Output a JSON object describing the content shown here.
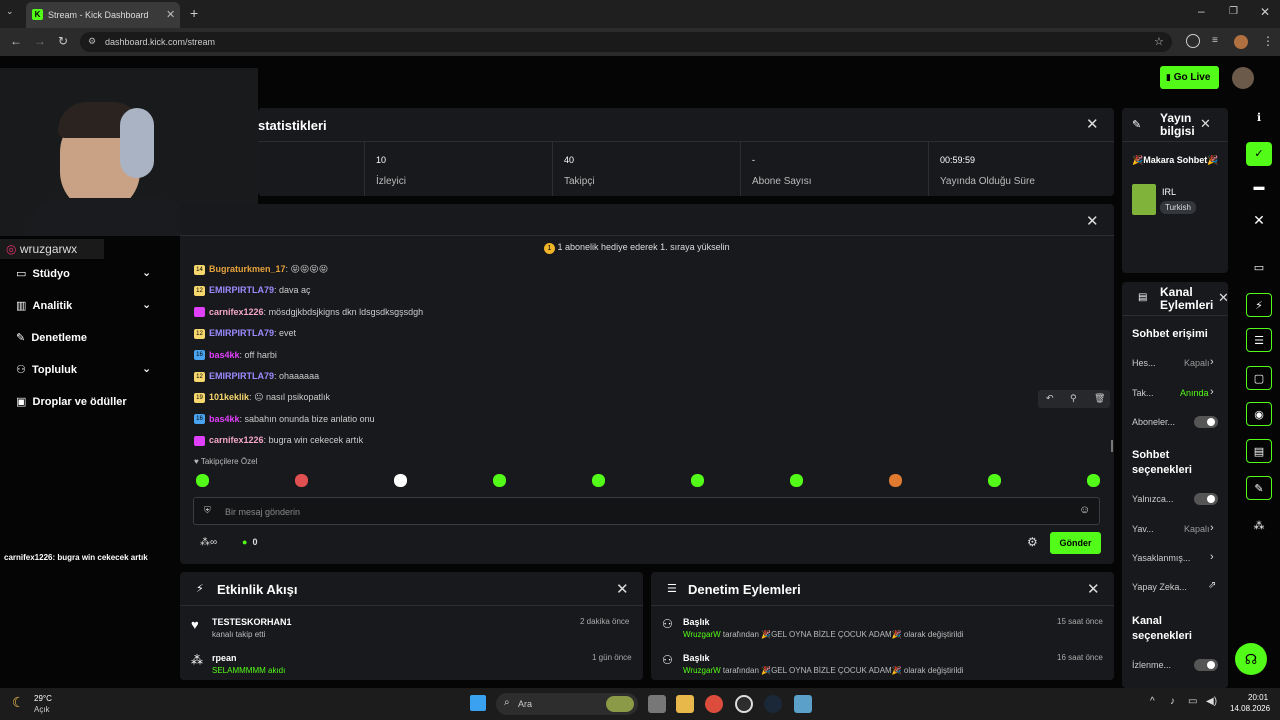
{
  "browser": {
    "tab_title": "Stream - Kick Dashboard",
    "url": "dashboard.kick.com/stream"
  },
  "header": {
    "go_live": "Go Live"
  },
  "stats": {
    "title": "statistikleri",
    "items": [
      {
        "value": "10",
        "label": "İzleyici"
      },
      {
        "value": "40",
        "label": "Takipçi"
      },
      {
        "value": "-",
        "label": "Abone Sayısı"
      },
      {
        "value": "00:59:59",
        "label": "Yayında Olduğu Süre"
      }
    ]
  },
  "overlay": {
    "instagram": "wruzgarwx",
    "chat_overlay_user": "carnifex1226",
    "chat_overlay_text": ": bugra win cekecek artık"
  },
  "sidebar": {
    "items": [
      {
        "label": "Stüdyo"
      },
      {
        "label": "Analitik"
      },
      {
        "label": "Denetleme"
      },
      {
        "label": "Topluluk"
      },
      {
        "label": "Droplar ve ödüller"
      }
    ]
  },
  "chat": {
    "banner": "1 abonelik hediye ederek 1. sıraya yükselin",
    "messages": [
      {
        "badge": "14",
        "user": "Bugraturkmen_17",
        "text": "😝😝😝😝",
        "color": "#e6a23c"
      },
      {
        "badge": "12",
        "user": "EMIRPIRTLA79",
        "text": "dava aç",
        "color": "#9b8cff"
      },
      {
        "badge": "",
        "user": "carnifex1226",
        "text": "mösdgjkbdsjkigns dkn ldsgsdksgşsdgh",
        "color": "#f2a7c8"
      },
      {
        "badge": "12",
        "user": "EMIRPIRTLA79",
        "text": "evet",
        "color": "#9b8cff"
      },
      {
        "badge": "16",
        "user": "bas4kk",
        "text": "off harbi",
        "color": "#e040fb"
      },
      {
        "badge": "12",
        "user": "EMIRPIRTLA79",
        "text": "ohaaaaaa",
        "color": "#9b8cff"
      },
      {
        "badge": "19",
        "user": "101keklik",
        "text": "😐 nasıl psikopatlık",
        "color": "#f5d76e"
      },
      {
        "badge": "16",
        "user": "bas4kk",
        "text": "sabahın onunda bize anlatio onu",
        "color": "#e040fb"
      },
      {
        "badge": "",
        "user": "carnifex1226",
        "text": "bugra win cekecek artık",
        "color": "#f2a7c8"
      }
    ],
    "followers_only": "Takipçilere Özel",
    "placeholder": "Bir mesaj gönderin",
    "points": "0",
    "send": "Gönder"
  },
  "activity": {
    "title": "Etkinlik Akışı",
    "items": [
      {
        "user": "TESTESKORHAN1",
        "sub": "kanalı takip etti",
        "time": "2 dakika önce"
      },
      {
        "user": "rpean",
        "sub": "SELAMMMMM akıdı",
        "time": "1 gün önce"
      }
    ]
  },
  "moderation": {
    "title": "Denetim Eylemleri",
    "items": [
      {
        "title": "Başlık",
        "who": "WruzgarW",
        "rest": "tarafından 🎉GEL OYNA BİZLE ÇOCUK ADAM🎉 olarak değiştirildi",
        "time": "15 saat önce"
      },
      {
        "title": "Başlık",
        "who": "WruzgarW",
        "rest": "tarafından 🎉GEL OYNA BİZLE ÇOCUK ADAM🎉 olarak değiştirildi",
        "time": "16 saat önce"
      }
    ]
  },
  "stream_info": {
    "title": "Yayın bilgisi",
    "stream_title": "🎉Makara Sohbet🎉",
    "category": "IRL",
    "language": "Turkish"
  },
  "channel_actions": {
    "title": "Kanal Eylemleri",
    "chat_access": "Sohbet erişimi",
    "rows1": [
      {
        "label": "Hes...",
        "value": "Kapalı"
      },
      {
        "label": "Tak...",
        "value": "Anında"
      },
      {
        "label": "Aboneler...",
        "value": ""
      }
    ],
    "chat_options": "Sohbet seçenekleri",
    "rows2": [
      {
        "label": "Yalnızca...",
        "value": ""
      },
      {
        "label": "Yav...",
        "value": "Kapalı"
      },
      {
        "label": "Yasaklanmış...",
        "value": ""
      },
      {
        "label": "Yapay Zeka...",
        "value": ""
      }
    ],
    "channel_options": "Kanal seçenekleri",
    "row3": "İzlenme..."
  },
  "taskbar": {
    "weather_temp": "29°C",
    "weather_desc": "Açık",
    "search": "Ara",
    "time": "20:01",
    "date": "14.08.2026"
  }
}
